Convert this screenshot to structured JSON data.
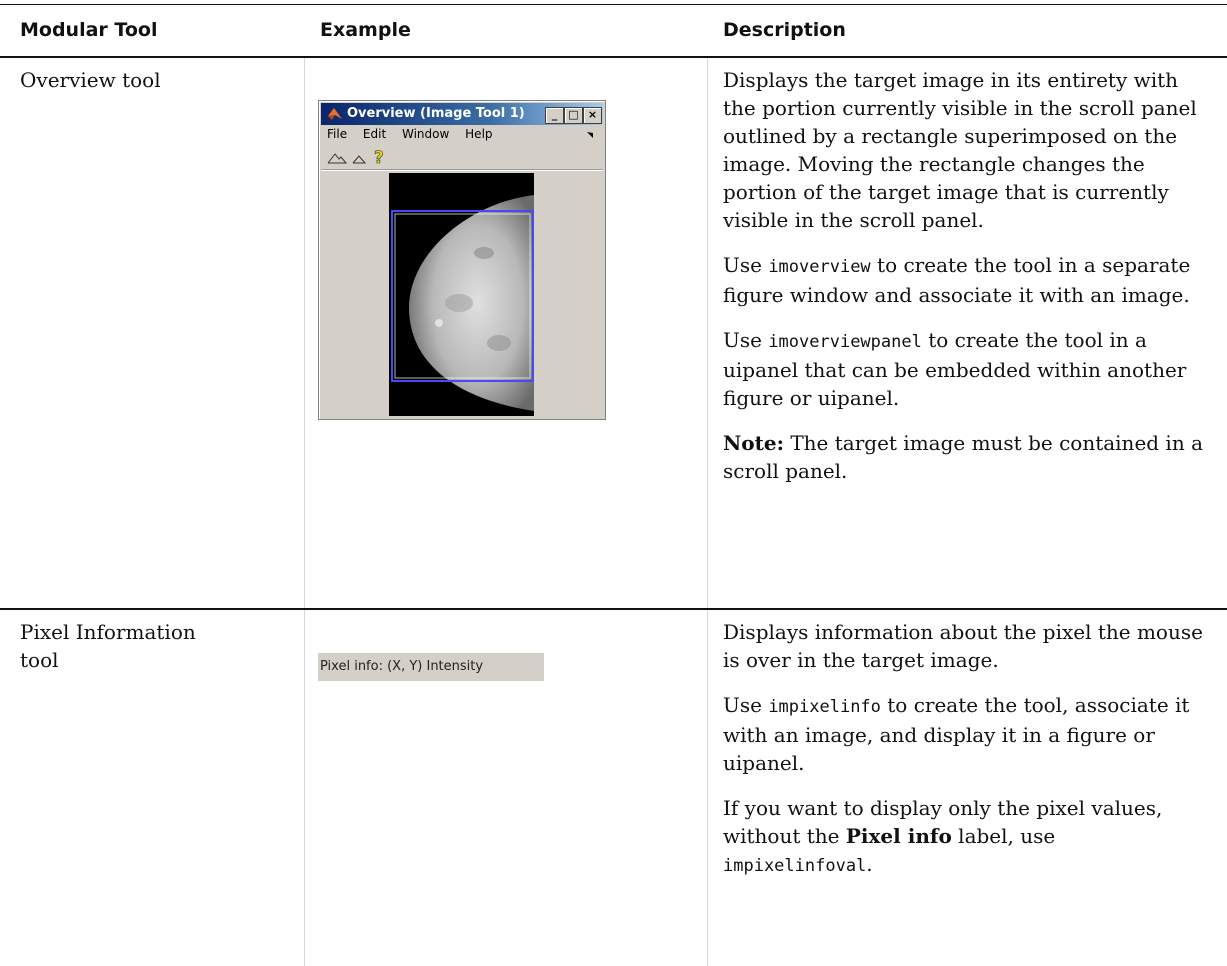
{
  "headers": {
    "modular_tool": "Modular Tool",
    "example": "Example",
    "description": "Description"
  },
  "rows": [
    {
      "tool": "Overview tool",
      "example_window": {
        "title": "Overview (Image Tool 1)",
        "menus": [
          "File",
          "Edit",
          "Window",
          "Help"
        ],
        "minimize_glyph": "_",
        "maximize_glyph": "□",
        "close_glyph": "×",
        "toolbar_icons": [
          "zoom-in-icon",
          "zoom-out-icon",
          "help-icon"
        ]
      },
      "description": {
        "p1": "Displays the target image in its entirety with the portion currently visible in the scroll panel outlined by a rectangle superimposed on the image. Moving the rectangle changes the portion of the target image that is currently visible in the scroll panel.",
        "p2_before": "Use ",
        "p2_code": "imoverview",
        "p2_after": " to create the tool in a separate figure window and associate it with an image.",
        "p3_before": "Use ",
        "p3_code": "imoverviewpanel",
        "p3_after": " to create the tool in a uipanel that can be embedded within another figure or uipanel.",
        "note_label": "Note:",
        "note_text": " The target image must be contained in a scroll panel."
      }
    },
    {
      "tool": "Pixel Information tool",
      "example_text": "Pixel info: (X, Y)  Intensity",
      "description": {
        "p1": "Displays information about the pixel the mouse is over in the target image.",
        "p2_before": "Use ",
        "p2_code": "impixelinfo",
        "p2_after": " to create the tool, associate it with an image, and display it in a figure or uipanel.",
        "p3_before": "If you want to display only the pixel values, without the ",
        "p3_bold": "Pixel info",
        "p3_middle": " label, use ",
        "p3_code": "impixelinfoval",
        "p3_after": "."
      }
    }
  ]
}
